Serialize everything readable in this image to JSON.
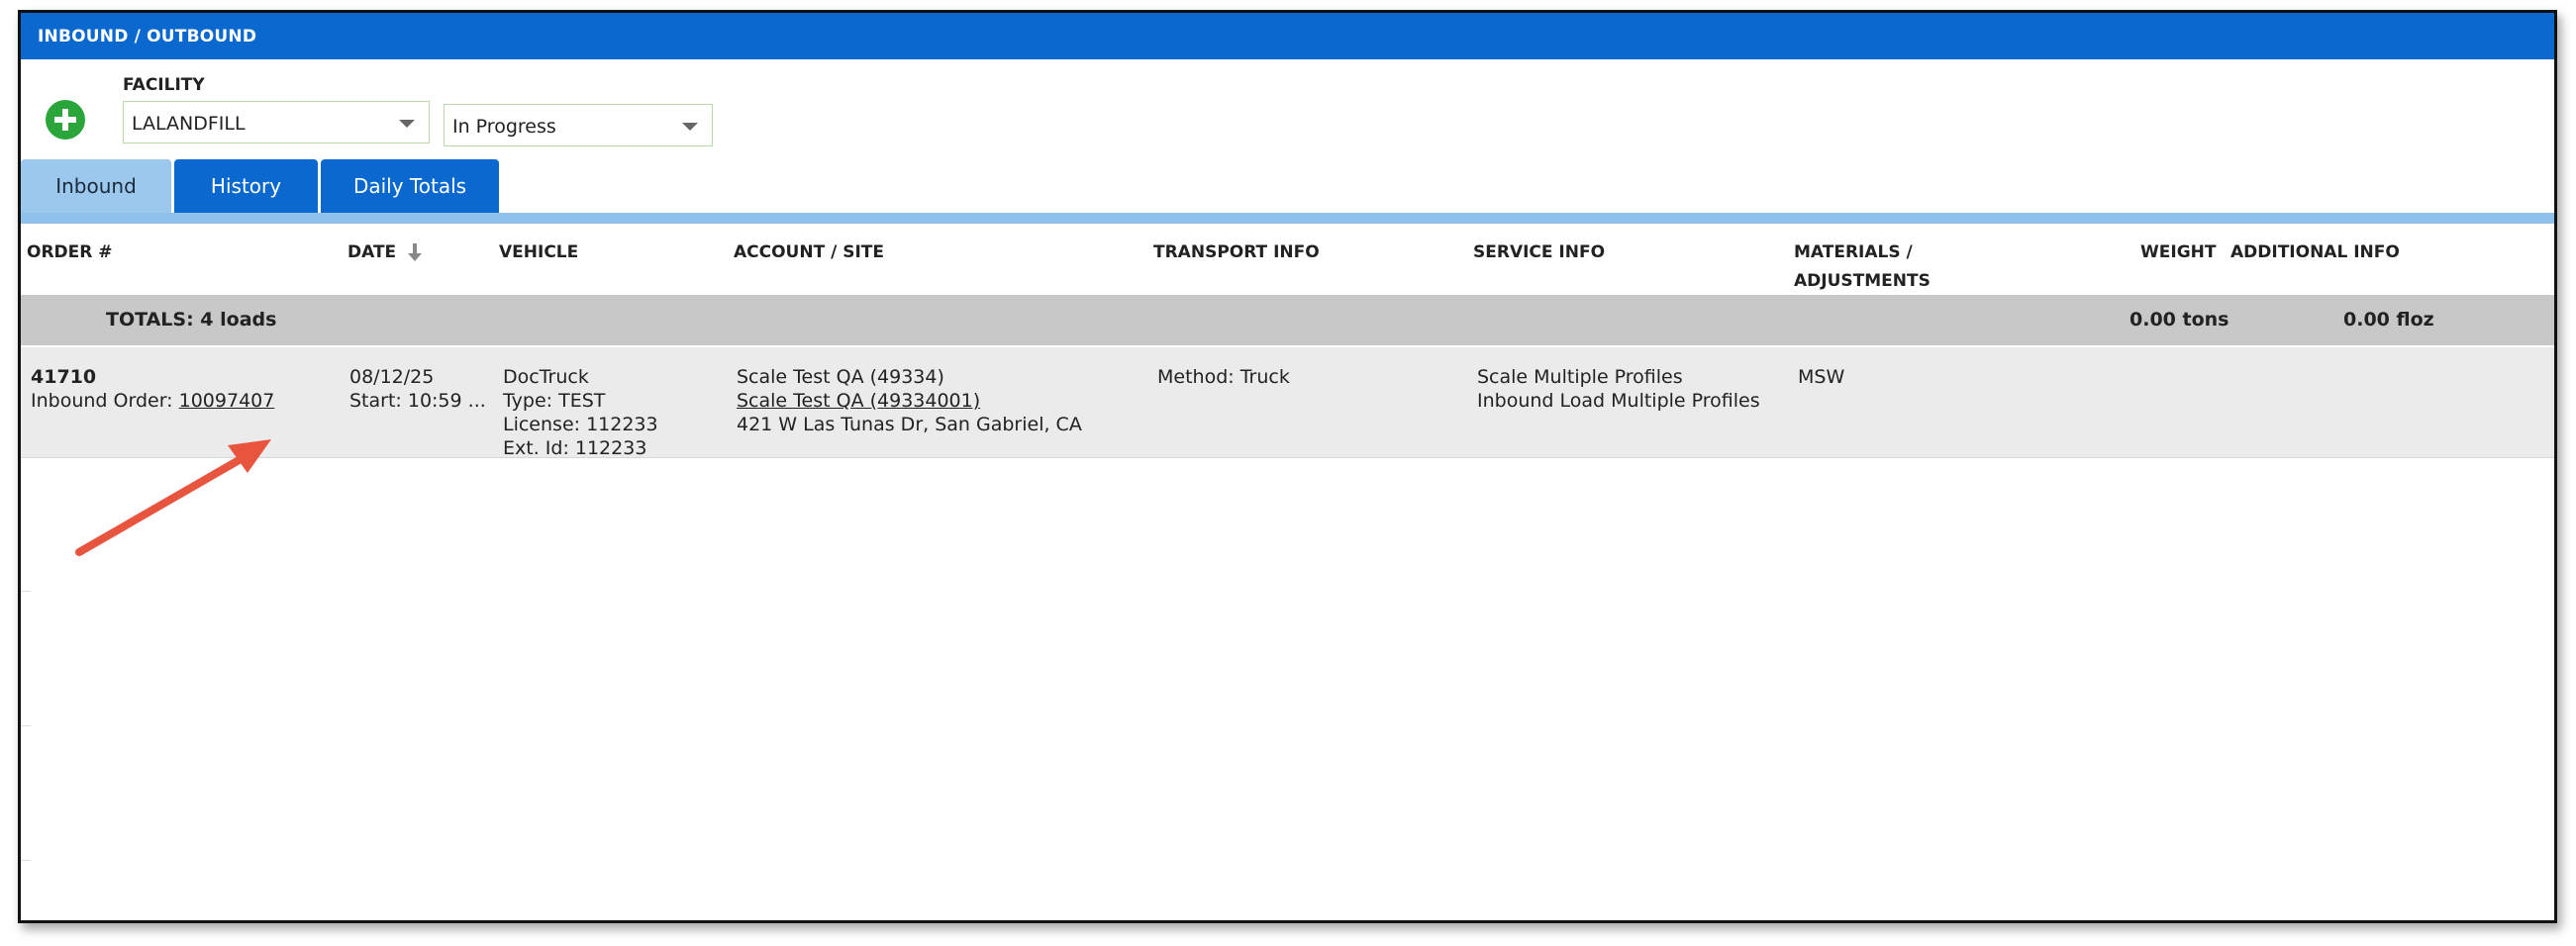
{
  "header": {
    "title": "INBOUND / OUTBOUND"
  },
  "filters": {
    "facility_label": "FACILITY",
    "facility_value": "LALANDFILL",
    "status_value": "In Progress"
  },
  "tabs": [
    {
      "label": "Inbound",
      "active": true
    },
    {
      "label": "History",
      "active": false
    },
    {
      "label": "Daily Totals",
      "active": false
    }
  ],
  "columns": {
    "order": "ORDER #",
    "date": "DATE",
    "vehicle": "VEHICLE",
    "account": "ACCOUNT / SITE",
    "transport": "TRANSPORT INFO",
    "service": "SERVICE INFO",
    "materials_line1": "MATERIALS /",
    "materials_line2": "ADJUSTMENTS",
    "weight": "WEIGHT",
    "additional": "ADDITIONAL INFO"
  },
  "totals": {
    "label": "TOTALS: 4 loads",
    "weight": "0.00 tons",
    "additional": "0.00 floz"
  },
  "rows": [
    {
      "order_number": "41710",
      "inbound_order_label": "Inbound Order:",
      "inbound_order_link": "10097407",
      "date": "08/12/25",
      "start": "Start: 10:59 ...",
      "vehicle_name": "DocTruck",
      "vehicle_type": "Type: TEST",
      "vehicle_license": "License: 112233",
      "vehicle_ext_id": "Ext. Id: 112233",
      "account": "Scale Test QA (49334)",
      "site_link": "Scale Test QA (49334001)",
      "address": "421 W Las Tunas Dr, San Gabriel, CA",
      "transport": "Method: Truck",
      "service_line1": "Scale Multiple Profiles",
      "service_line2": "Inbound Load Multiple Profiles",
      "materials": "MSW"
    }
  ],
  "colors": {
    "header_blue": "#0a68cf",
    "tab_active": "#9cc8ee",
    "add_green": "#2aa53a",
    "annotation_arrow": "#e8553f"
  }
}
